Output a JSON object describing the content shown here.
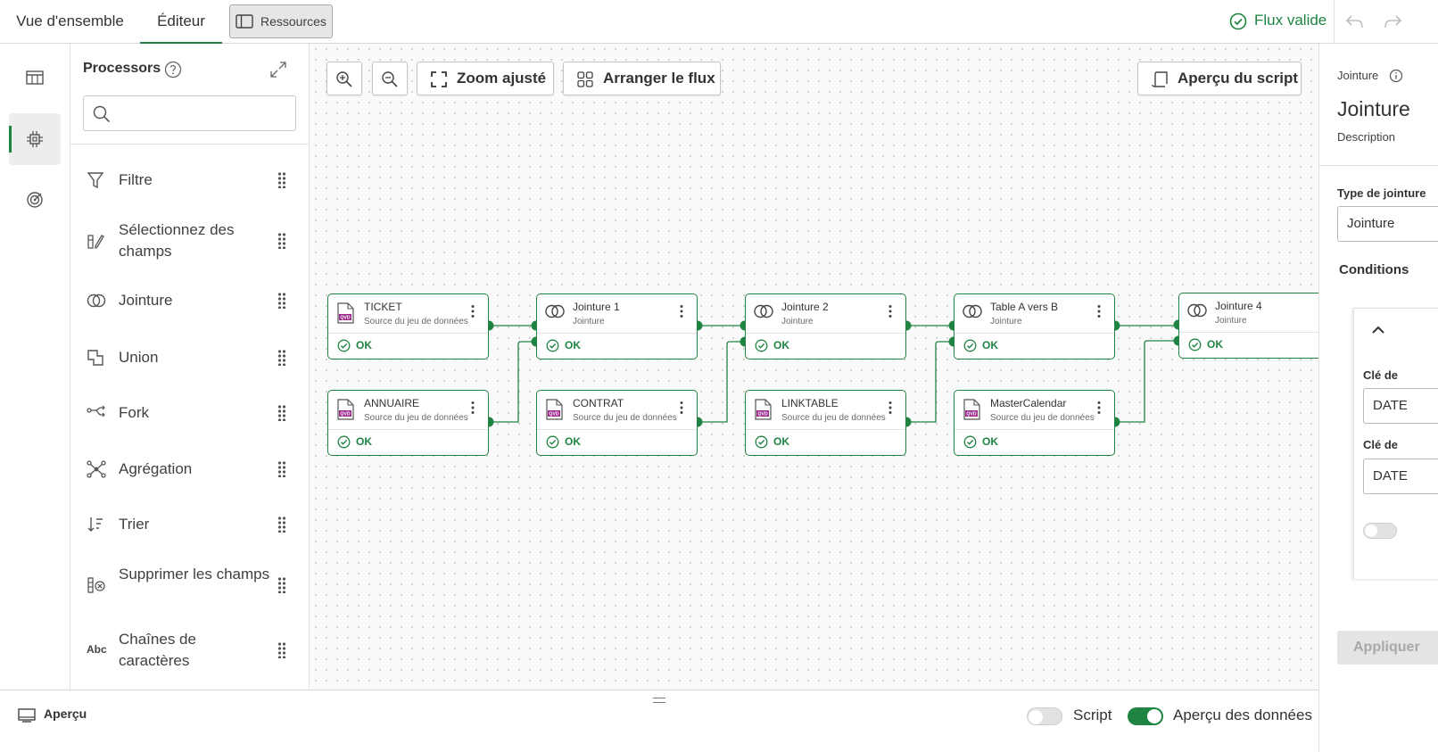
{
  "header": {
    "tabs": [
      {
        "label": "Vue d'ensemble",
        "active": false
      },
      {
        "label": "Éditeur",
        "active": true
      }
    ],
    "resources_button": "Ressources",
    "status": "Flux valide",
    "status_color": "#1f8442"
  },
  "rail": {
    "items": [
      {
        "icon": "table-icon",
        "active": false
      },
      {
        "icon": "processor-chip-icon",
        "active": true
      },
      {
        "icon": "target-icon",
        "active": false
      }
    ]
  },
  "processors_panel": {
    "title": "Processors",
    "search_value": "",
    "items": [
      {
        "label": "Filtre",
        "icon": "filter-icon"
      },
      {
        "label": "Sélectionnez des champs",
        "icon": "select-fields-icon"
      },
      {
        "label": "Jointure",
        "icon": "join-icon"
      },
      {
        "label": "Union",
        "icon": "union-icon"
      },
      {
        "label": "Fork",
        "icon": "fork-icon"
      },
      {
        "label": "Agrégation",
        "icon": "aggregation-icon"
      },
      {
        "label": "Trier",
        "icon": "sort-icon"
      },
      {
        "label": "Supprimer les champs",
        "icon": "remove-fields-icon"
      },
      {
        "label": "Chaînes de caractères",
        "icon": "abc-icon"
      }
    ]
  },
  "canvas": {
    "toolbar": {
      "zoom_fit": "Zoom ajusté",
      "arrange": "Arranger le flux",
      "script_preview": "Aperçu du script"
    },
    "nodes": [
      {
        "id": "ticket",
        "title": "TICKET",
        "subtitle": "Source du jeu de données",
        "kind": "qvd",
        "status": "OK"
      },
      {
        "id": "annuaire",
        "title": "ANNUAIRE",
        "subtitle": "Source du jeu de données",
        "kind": "qvd",
        "status": "OK"
      },
      {
        "id": "jointure1",
        "title": "Jointure 1",
        "subtitle": "Jointure",
        "kind": "join",
        "status": "OK"
      },
      {
        "id": "contrat",
        "title": "CONTRAT",
        "subtitle": "Source du jeu de données",
        "kind": "qvd",
        "status": "OK"
      },
      {
        "id": "jointure2",
        "title": "Jointure 2",
        "subtitle": "Jointure",
        "kind": "join",
        "status": "OK"
      },
      {
        "id": "linktable",
        "title": "LINKTABLE",
        "subtitle": "Source du jeu de données",
        "kind": "qvd",
        "status": "OK"
      },
      {
        "id": "tableavb",
        "title": "Table A vers B",
        "subtitle": "Jointure",
        "kind": "join",
        "status": "OK"
      },
      {
        "id": "mastercal",
        "title": "MasterCalendar",
        "subtitle": "Source du jeu de données",
        "kind": "qvd",
        "status": "OK"
      },
      {
        "id": "jointure4",
        "title": "Jointure 4",
        "subtitle": "Jointure",
        "kind": "join",
        "status": "OK"
      }
    ]
  },
  "properties_panel": {
    "breadcrumb": "Jointure",
    "title": "Jointure",
    "description_label": "Description",
    "join_type_label": "Type de jointure",
    "join_type_value": "Jointure",
    "conditions_label": "Conditions",
    "key1_label": "Clé de",
    "key1_value": "DATE",
    "key2_label": "Clé de",
    "key2_value": "DATE",
    "apply_label": "Appliquer"
  },
  "bottom_bar": {
    "preview_tab": "Aperçu",
    "script_toggle_label": "Script",
    "script_toggle_on": false,
    "data_preview_label": "Aperçu des données",
    "data_preview_on": true
  }
}
